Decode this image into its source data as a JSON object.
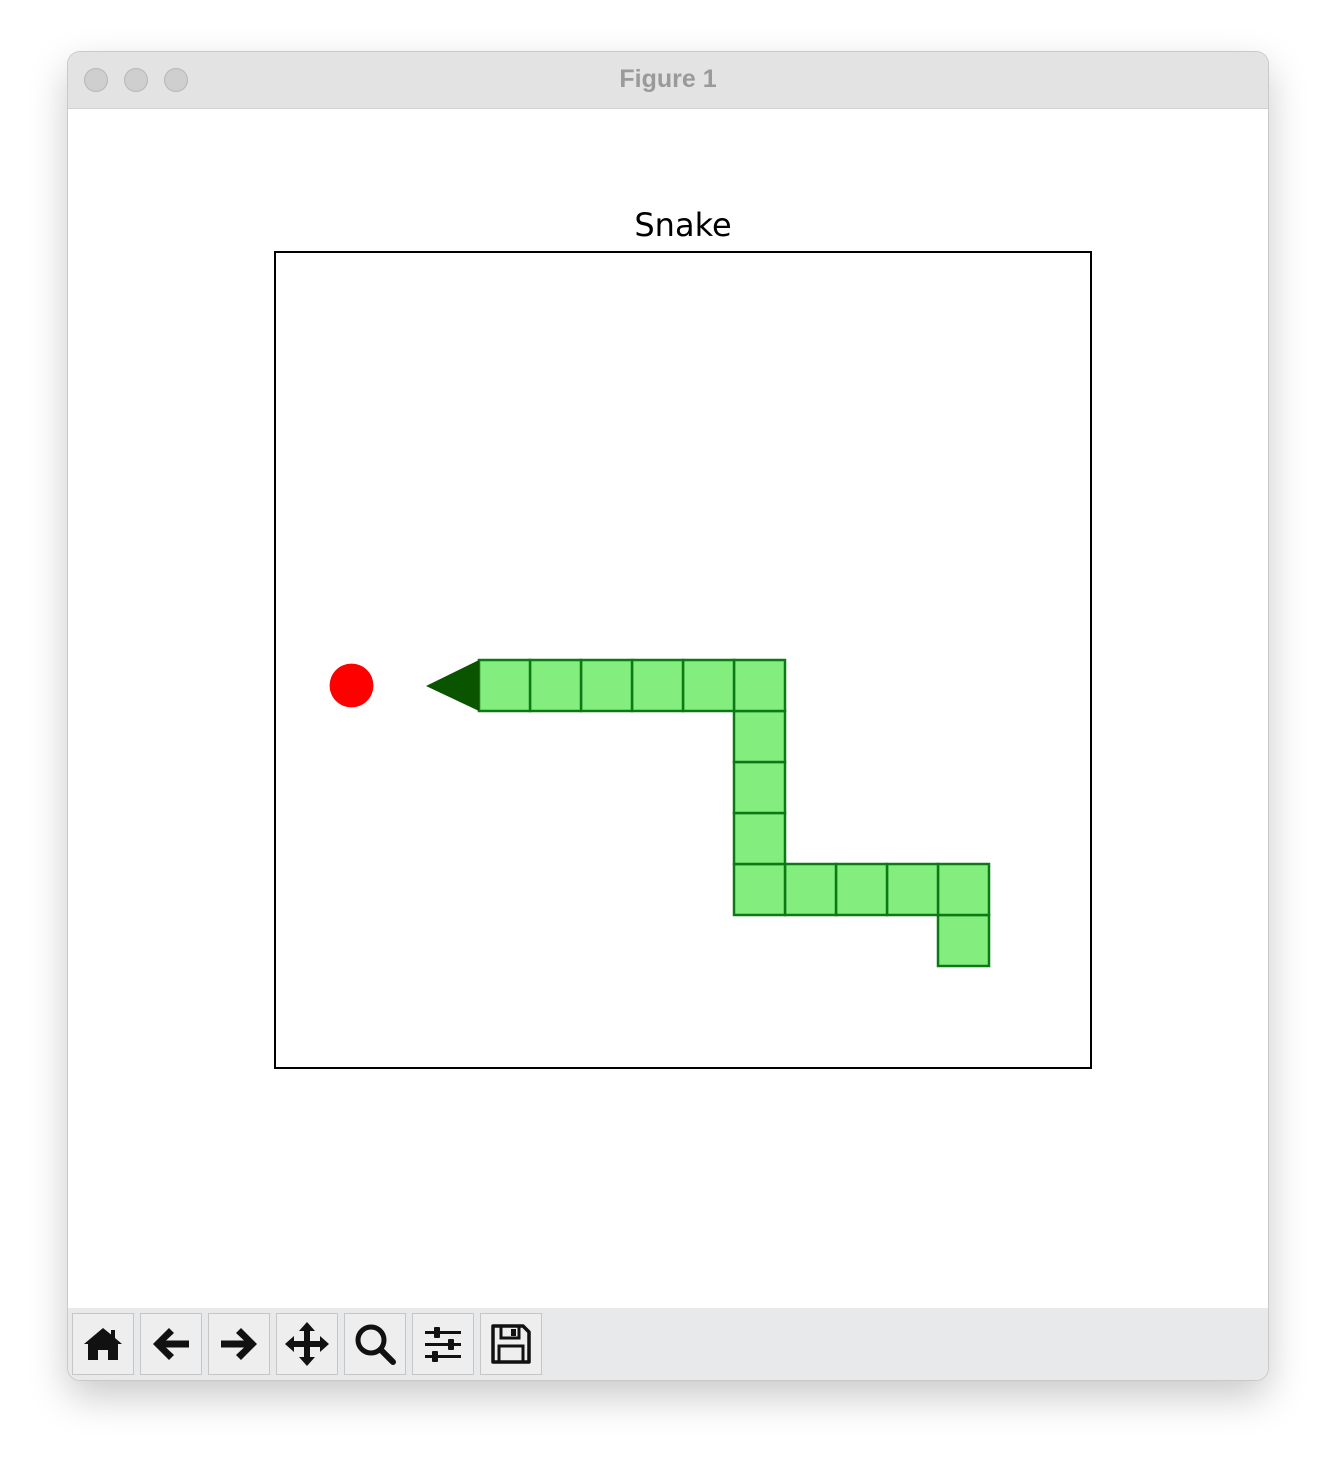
{
  "window": {
    "title": "Figure 1"
  },
  "figure": {
    "title": "Snake"
  },
  "game": {
    "board_cells": 16,
    "snake_body": [
      [
        13,
        13
      ],
      [
        13,
        12
      ],
      [
        12,
        12
      ],
      [
        11,
        12
      ],
      [
        10,
        12
      ],
      [
        9,
        12
      ],
      [
        9,
        11
      ],
      [
        9,
        10
      ],
      [
        9,
        9
      ],
      [
        9,
        8
      ],
      [
        8,
        8
      ],
      [
        7,
        8
      ],
      [
        6,
        8
      ],
      [
        5,
        8
      ],
      [
        4,
        8
      ]
    ],
    "snake_head": [
      3,
      8
    ],
    "head_direction": "left",
    "food": [
      1.5,
      8.5
    ],
    "colors": {
      "snake_fill": "#83ee7e",
      "snake_stroke": "#0b7a14",
      "head_fill": "#0a5400",
      "food": "#ff0000",
      "board_border": "#000000"
    }
  },
  "toolbar": {
    "buttons": [
      {
        "name": "home-button",
        "icon": "home-icon"
      },
      {
        "name": "back-button",
        "icon": "arrow-left-icon"
      },
      {
        "name": "forward-button",
        "icon": "arrow-right-icon"
      },
      {
        "name": "pan-button",
        "icon": "move-icon"
      },
      {
        "name": "zoom-button",
        "icon": "search-icon"
      },
      {
        "name": "configure-subplots-button",
        "icon": "sliders-icon"
      },
      {
        "name": "save-button",
        "icon": "floppy-icon"
      }
    ]
  }
}
